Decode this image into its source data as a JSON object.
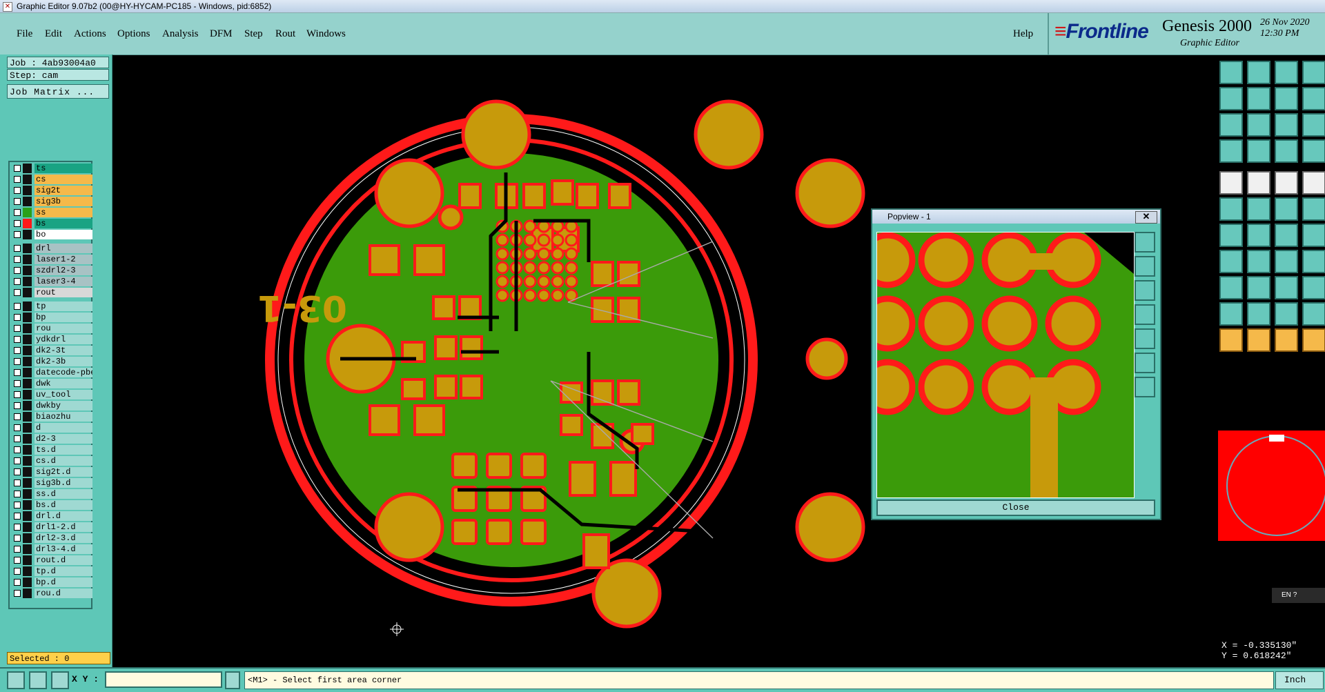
{
  "window": {
    "title": "Graphic Editor 9.07b2 (00@HY-HYCAM-PC185 - Windows, pid:6852)"
  },
  "menu": {
    "items": [
      "File",
      "Edit",
      "Actions",
      "Options",
      "Analysis",
      "DFM",
      "Step",
      "Rout",
      "Windows"
    ],
    "help": "Help"
  },
  "brand": {
    "logo": "Frontline",
    "product": "Genesis 2000",
    "subtitle": "Graphic Editor",
    "date": "26 Nov 2020",
    "time": "12:30 PM"
  },
  "info": {
    "job": "Job : 4ab93004a0",
    "step": "Step: cam",
    "matrix_button": "Job Matrix ..."
  },
  "layers": [
    {
      "name": "ts",
      "color": "#19a383",
      "swatch": "#111"
    },
    {
      "name": "cs",
      "color": "#f5b94a",
      "swatch": "#111"
    },
    {
      "name": "sig2t",
      "color": "#f5b94a",
      "swatch": "#111"
    },
    {
      "name": "sig3b",
      "color": "#f5b94a",
      "swatch": "#111"
    },
    {
      "name": "ss",
      "color": "#f5b94a",
      "swatch": "#2aa01a"
    },
    {
      "name": "bs",
      "color": "#19a383",
      "swatch": "#ff1a1a"
    },
    {
      "name": "bo",
      "color": "#ffffff",
      "swatch": "#111"
    },
    {
      "name": "drl",
      "color": "#a8c2c4",
      "swatch": "#111"
    },
    {
      "name": "laser1-2",
      "color": "#a8c2c4",
      "swatch": "#111"
    },
    {
      "name": "szdrl2-3",
      "color": "#a8c2c4",
      "swatch": "#111"
    },
    {
      "name": "laser3-4",
      "color": "#a8c2c4",
      "swatch": "#111"
    },
    {
      "name": "rout",
      "color": "#d8d8d8",
      "swatch": "#111"
    },
    {
      "name": "tp",
      "color": "#9fd9d2",
      "swatch": "#111"
    },
    {
      "name": "bp",
      "color": "#9fd9d2",
      "swatch": "#111"
    },
    {
      "name": "rou",
      "color": "#9fd9d2",
      "swatch": "#111"
    },
    {
      "name": "ydkdrl",
      "color": "#9fd9d2",
      "swatch": "#111"
    },
    {
      "name": "dk2-3t",
      "color": "#9fd9d2",
      "swatch": "#111"
    },
    {
      "name": "dk2-3b",
      "color": "#9fd9d2",
      "swatch": "#111"
    },
    {
      "name": "datecode-pbe",
      "color": "#9fd9d2",
      "swatch": "#111"
    },
    {
      "name": "dwk",
      "color": "#9fd9d2",
      "swatch": "#111"
    },
    {
      "name": "uv_tool",
      "color": "#9fd9d2",
      "swatch": "#111"
    },
    {
      "name": "dwkby",
      "color": "#9fd9d2",
      "swatch": "#111"
    },
    {
      "name": "biaozhu",
      "color": "#9fd9d2",
      "swatch": "#111"
    },
    {
      "name": "d",
      "color": "#9fd9d2",
      "swatch": "#111"
    },
    {
      "name": "d2-3",
      "color": "#9fd9d2",
      "swatch": "#111"
    },
    {
      "name": "ts.d",
      "color": "#9fd9d2",
      "swatch": "#111"
    },
    {
      "name": "cs.d",
      "color": "#9fd9d2",
      "swatch": "#111"
    },
    {
      "name": "sig2t.d",
      "color": "#9fd9d2",
      "swatch": "#111"
    },
    {
      "name": "sig3b.d",
      "color": "#9fd9d2",
      "swatch": "#111"
    },
    {
      "name": "ss.d",
      "color": "#9fd9d2",
      "swatch": "#111"
    },
    {
      "name": "bs.d",
      "color": "#9fd9d2",
      "swatch": "#111"
    },
    {
      "name": "drl.d",
      "color": "#9fd9d2",
      "swatch": "#111"
    },
    {
      "name": "drl1-2.d",
      "color": "#9fd9d2",
      "swatch": "#111"
    },
    {
      "name": "drl2-3.d",
      "color": "#9fd9d2",
      "swatch": "#111"
    },
    {
      "name": "drl3-4.d",
      "color": "#9fd9d2",
      "swatch": "#111"
    },
    {
      "name": "rout.d",
      "color": "#9fd9d2",
      "swatch": "#111"
    },
    {
      "name": "tp.d",
      "color": "#9fd9d2",
      "swatch": "#111"
    },
    {
      "name": "bp.d",
      "color": "#9fd9d2",
      "swatch": "#111"
    },
    {
      "name": "rou.d",
      "color": "#9fd9d2",
      "swatch": "#111"
    }
  ],
  "selected": "Selected : 0",
  "board": {
    "silkscreen": "03-1"
  },
  "popview": {
    "title": "Popview - 1",
    "close_label": "Close",
    "close_x": "✕"
  },
  "coords": {
    "x": "X = -0.335130\"",
    "y": "Y =  0.618242\""
  },
  "status": {
    "xy_label": "X Y :",
    "message": "<M1> - Select first area corner",
    "unit": "Inch",
    "lang": "EN"
  },
  "colors": {
    "pad": "#c79a0b",
    "copper": "#3b9b0a",
    "mask": "#ff1a1a",
    "panel": "#5ec7b7"
  }
}
